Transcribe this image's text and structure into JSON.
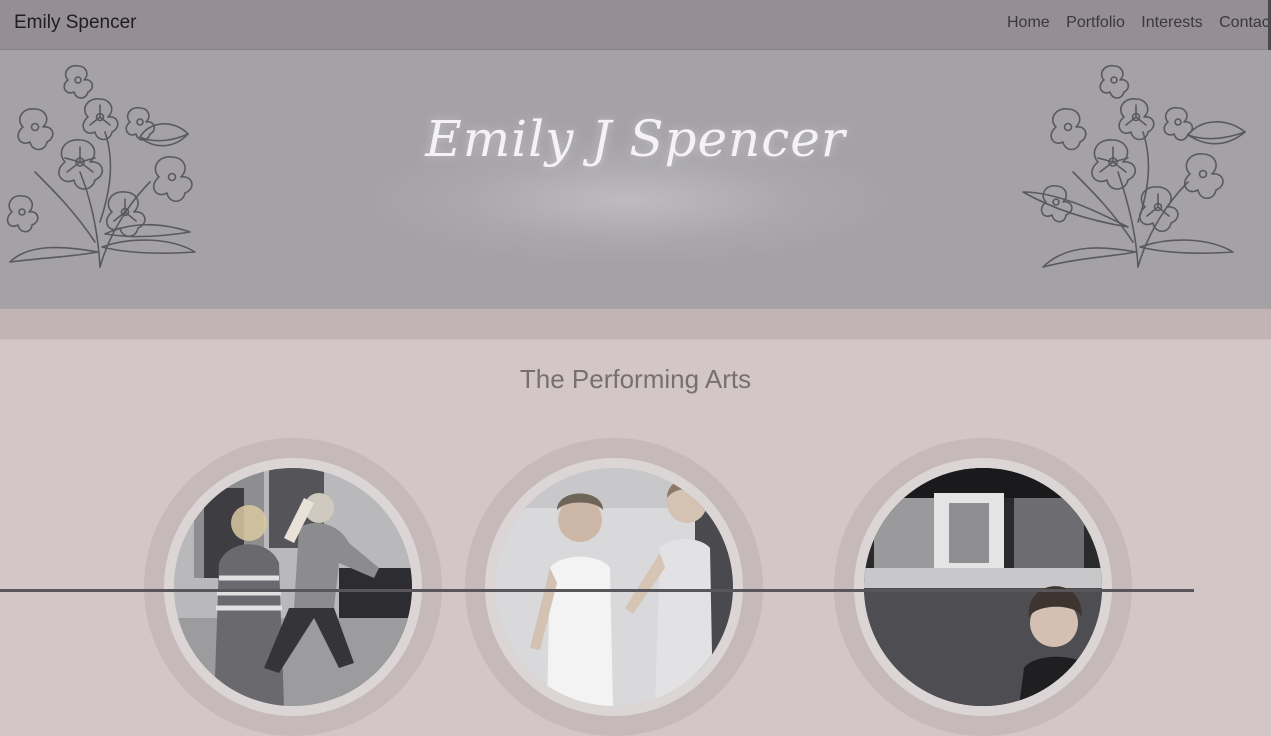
{
  "navbar": {
    "brand": "Emily Spencer",
    "links": [
      "Home",
      "Portfolio",
      "Interests",
      "Contac"
    ]
  },
  "hero": {
    "title": "Emily J Spencer"
  },
  "section": {
    "title": "The Performing Arts",
    "items": [
      {
        "image": "two-dancers-rehearsing-photo"
      },
      {
        "image": "two-young-ballet-students-photo"
      },
      {
        "image": "young-woman-with-artwork-photo"
      }
    ]
  },
  "colors": {
    "navbar": "#958f95",
    "hero": "#a4a2a5",
    "band": "#c2b4b5",
    "page": "#d3c6c7",
    "ring": "#c6b9ba"
  }
}
